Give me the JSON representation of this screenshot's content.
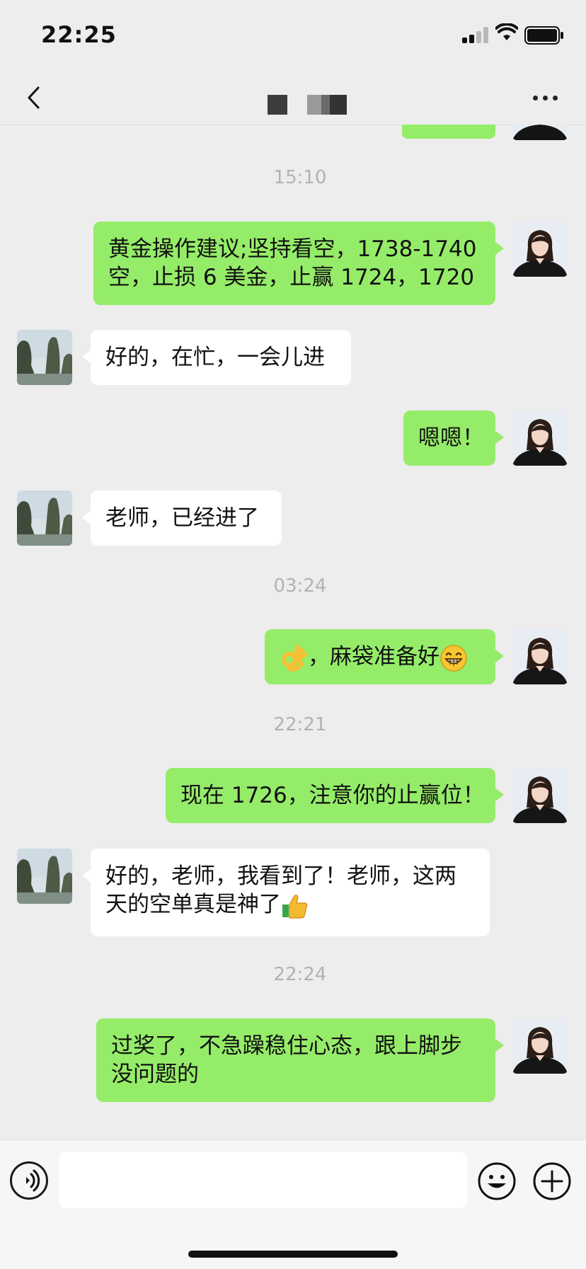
{
  "status_bar": {
    "time": "22:25"
  },
  "header": {
    "title": "",
    "more_label": "more"
  },
  "messages": [
    {
      "kind": "time",
      "text": "15:10"
    },
    {
      "kind": "msg",
      "from": "me",
      "lines": [
        "黄金操作建议;坚持看空，1738-1740",
        "空，止损 6 美金，止赢 1724，1720"
      ]
    },
    {
      "kind": "msg",
      "from": "other",
      "lines": [
        "好的，在忙，一会儿进"
      ]
    },
    {
      "kind": "msg",
      "from": "me",
      "lines": [
        "嗯嗯！"
      ]
    },
    {
      "kind": "msg",
      "from": "other",
      "lines": [
        "老师，已经进了"
      ]
    },
    {
      "kind": "time",
      "text": "03:24"
    },
    {
      "kind": "msg",
      "from": "me",
      "lines": [
        "，麻袋准备好"
      ],
      "emoji_before": "ok-hand",
      "emoji_after": "grin"
    },
    {
      "kind": "time",
      "text": "22:21"
    },
    {
      "kind": "msg",
      "from": "me",
      "lines": [
        "现在 1726，注意你的止赢位！"
      ]
    },
    {
      "kind": "msg",
      "from": "other",
      "lines": [
        "好的，老师，我看到了！老师，这两",
        "天的空单真是神了"
      ],
      "emoji_after": "thumbs-up"
    },
    {
      "kind": "time",
      "text": "22:24"
    },
    {
      "kind": "msg",
      "from": "me",
      "lines": [
        "过奖了，不急躁稳住心态，跟上脚步",
        "没问题的"
      ]
    }
  ],
  "input": {
    "placeholder": ""
  },
  "colors": {
    "me_bubble": "#95ec69",
    "other_bubble": "#ffffff",
    "background": "#ededed"
  }
}
